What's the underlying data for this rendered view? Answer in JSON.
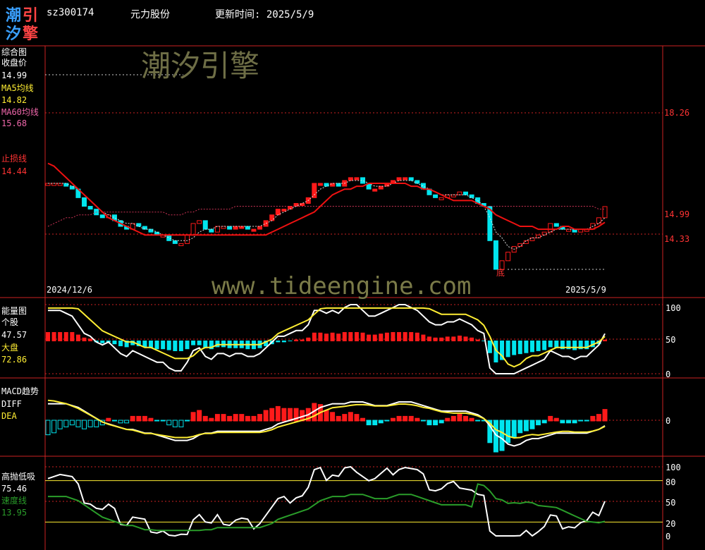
{
  "header": {
    "logo_chars": [
      "潮",
      "引",
      "汐",
      "擎"
    ],
    "stock_code": "sz300174",
    "stock_name": "元力股份",
    "update_time": "更新时间: 2025/5/9"
  },
  "watermark": {
    "brand": "潮汐引擎",
    "url": "www.tideengine.com"
  },
  "colors": {
    "bg": "#000000",
    "divider": "#cc2222",
    "red_candle": "#ff1a1a",
    "cyan_candle": "#00e5ee",
    "ma5": "#ffffff",
    "ma60": "#cc3355",
    "stoploss": "#ee1111",
    "yellow": "#ffee33",
    "green": "#2a9d2a"
  },
  "panel_main": {
    "title": "综合图",
    "close_label": "收盘价",
    "close_value": "14.99",
    "ma5_label": "MA5均线",
    "ma5_value": "14.82",
    "ma60_label": "MA60均线",
    "ma60_value": "15.68",
    "stop_label": "止损线",
    "stop_value": "14.44",
    "price_ticks": [
      "18.26",
      "14.99",
      "14.33"
    ],
    "date_start": "2024/12/6",
    "date_end": "2025/5/9",
    "marker": "底"
  },
  "panel_energy": {
    "title": "能量图",
    "stock_label": "个股",
    "stock_value": "47.57",
    "market_label": "大盘",
    "market_value": "72.86",
    "ticks": [
      "100",
      "50",
      "0"
    ]
  },
  "panel_macd": {
    "title": "MACD趋势",
    "diff_label": "DIFF",
    "dea_label": "DEA",
    "ticks": [
      "0"
    ]
  },
  "panel_gaopao": {
    "title": "高抛低吸",
    "main_value": "75.46",
    "speed_label": "速度线",
    "speed_value": "13.95",
    "ticks": [
      "100",
      "80",
      "50",
      "20",
      "0"
    ]
  },
  "chart_data": {
    "type": "candlestick",
    "x": [
      "2024/12/6",
      "2025/5/9"
    ],
    "close_series": [
      15.8,
      15.8,
      15.8,
      15.7,
      15.6,
      15.3,
      15.0,
      14.9,
      14.7,
      14.6,
      14.7,
      14.5,
      14.3,
      14.2,
      14.4,
      14.3,
      14.2,
      14.1,
      14.0,
      14.0,
      13.8,
      13.7,
      13.7,
      14.0,
      14.4,
      14.5,
      14.2,
      14.1,
      14.3,
      14.3,
      14.2,
      14.3,
      14.3,
      14.2,
      14.2,
      14.3,
      14.5,
      14.7,
      14.9,
      14.9,
      15.0,
      15.1,
      15.1,
      15.3,
      15.8,
      15.8,
      15.7,
      15.8,
      15.7,
      15.9,
      16.0,
      16.0,
      15.8,
      15.6,
      15.6,
      15.7,
      15.8,
      15.9,
      16.0,
      16.0,
      15.9,
      15.8,
      15.6,
      15.4,
      15.3,
      15.3,
      15.4,
      15.4,
      15.5,
      15.4,
      15.3,
      15.1,
      15.0,
      13.8,
      12.8,
      13.1,
      13.4,
      13.6,
      13.7,
      13.8,
      13.9,
      14.0,
      14.1,
      14.4,
      14.3,
      14.2,
      14.2,
      14.1,
      14.2,
      14.2,
      14.4,
      14.6,
      14.99
    ],
    "ma5_series": [
      15.8,
      15.8,
      15.8,
      15.8,
      15.7,
      15.6,
      15.4,
      15.2,
      15.0,
      14.8,
      14.7,
      14.6,
      14.5,
      14.4,
      14.4,
      14.3,
      14.2,
      14.2,
      14.1,
      14.0,
      13.9,
      13.8,
      13.8,
      13.8,
      13.9,
      14.1,
      14.2,
      14.2,
      14.3,
      14.3,
      14.3,
      14.3,
      14.3,
      14.3,
      14.3,
      14.3,
      14.4,
      14.5,
      14.7,
      14.8,
      14.9,
      15.0,
      15.1,
      15.2,
      15.4,
      15.6,
      15.7,
      15.8,
      15.8,
      15.8,
      15.9,
      15.9,
      15.9,
      15.8,
      15.7,
      15.7,
      15.7,
      15.8,
      15.9,
      15.9,
      15.9,
      15.8,
      15.7,
      15.6,
      15.5,
      15.4,
      15.4,
      15.4,
      15.4,
      15.4,
      15.3,
      15.2,
      15.0,
      14.6,
      14.1,
      13.9,
      13.6,
      13.5,
      13.6,
      13.8,
      13.9,
      13.9,
      14.0,
      14.1,
      14.2,
      14.2,
      14.2,
      14.2,
      14.2,
      14.2,
      14.3,
      14.4,
      14.6
    ],
    "ma60_series": [
      14.3,
      14.4,
      14.5,
      14.6,
      14.6,
      14.7,
      14.7,
      14.7,
      14.8,
      14.8,
      14.8,
      14.8,
      14.8,
      14.8,
      14.8,
      14.8,
      14.8,
      14.8,
      14.8,
      14.8,
      14.7,
      14.7,
      14.7,
      14.8,
      14.8,
      14.9,
      14.9,
      14.9,
      14.9,
      14.9,
      14.9,
      15.0,
      15.0,
      15.0,
      15.0,
      15.0,
      15.0,
      15.0,
      15.0,
      15.0,
      15.0,
      15.0,
      15.0,
      15.0,
      15.0,
      15.0,
      15.0,
      15.0,
      15.0,
      15.0,
      15.0,
      15.0,
      15.0,
      15.0,
      15.0,
      15.0,
      15.0,
      15.0,
      15.0,
      15.0,
      15.0,
      15.0,
      15.0,
      15.0,
      15.0,
      15.0,
      15.0,
      15.0,
      15.0,
      15.0,
      15.0,
      15.0,
      15.0,
      15.0,
      15.0,
      15.0,
      15.0,
      15.0,
      15.0,
      15.0,
      15.0,
      15.0,
      15.0,
      15.0,
      15.0,
      15.0,
      15.0,
      15.0,
      15.0,
      15.0,
      15.0,
      14.9,
      14.9
    ],
    "stop_series": [
      16.5,
      16.4,
      16.2,
      16.0,
      15.8,
      15.6,
      15.4,
      15.2,
      15.0,
      14.8,
      14.6,
      14.5,
      14.4,
      14.3,
      14.2,
      14.1,
      14.0,
      14.0,
      14.0,
      14.0,
      14.0,
      14.0,
      14.0,
      14.0,
      14.0,
      14.0,
      14.0,
      14.0,
      14.0,
      14.0,
      14.0,
      14.0,
      14.0,
      14.0,
      14.0,
      14.0,
      14.0,
      14.1,
      14.2,
      14.3,
      14.4,
      14.5,
      14.6,
      14.7,
      14.8,
      15.0,
      15.2,
      15.4,
      15.5,
      15.6,
      15.6,
      15.7,
      15.7,
      15.8,
      15.8,
      15.8,
      15.8,
      15.8,
      15.8,
      15.8,
      15.7,
      15.7,
      15.6,
      15.6,
      15.5,
      15.4,
      15.3,
      15.2,
      15.2,
      15.2,
      15.2,
      15.1,
      15.0,
      14.9,
      14.7,
      14.6,
      14.5,
      14.4,
      14.3,
      14.3,
      14.3,
      14.2,
      14.2,
      14.2,
      14.2,
      14.3,
      14.3,
      14.2,
      14.2,
      14.2,
      14.2,
      14.3,
      14.44
    ]
  }
}
